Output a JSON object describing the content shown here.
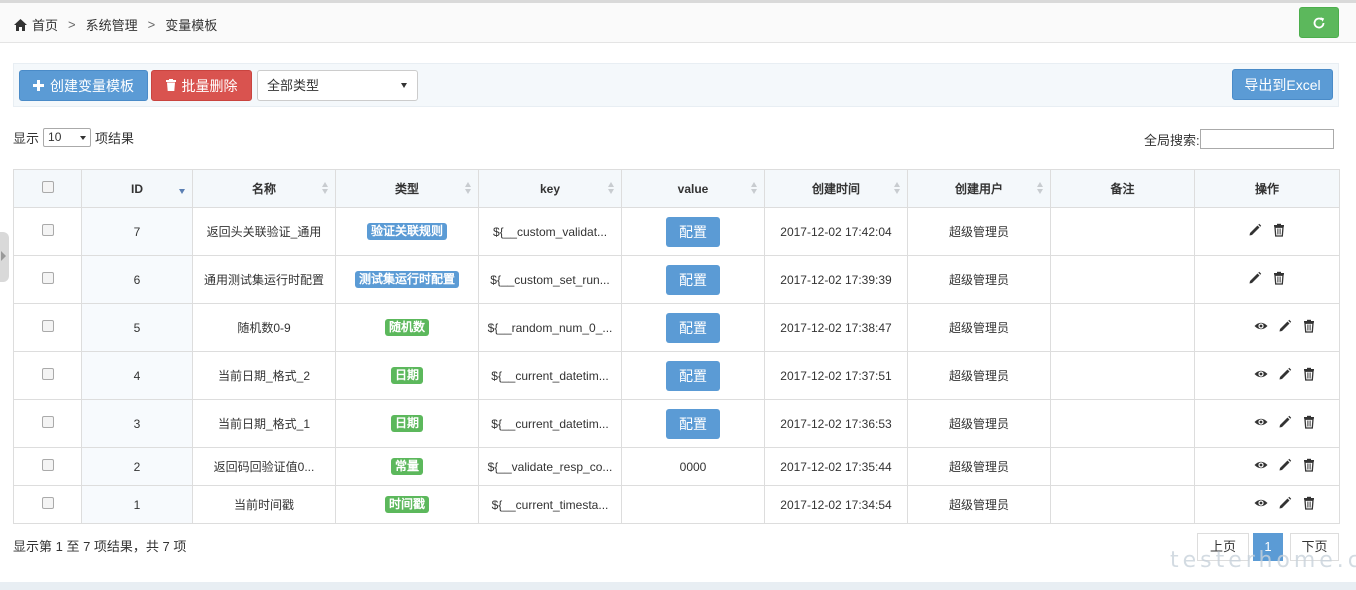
{
  "breadcrumb": {
    "home": "首页",
    "sep": ">",
    "level2": "系统管理",
    "level3": "变量模板"
  },
  "toolbar": {
    "create_label": "创建变量模板",
    "delete_label": "批量删除",
    "type_select": "全部类型",
    "export_label": "导出到Excel"
  },
  "listing": {
    "show_prefix": "显示",
    "length_value": "10",
    "show_suffix": "项结果",
    "search_label": "全局搜索:"
  },
  "columns": {
    "id": "ID",
    "name": "名称",
    "type": "类型",
    "key": "key",
    "value": "value",
    "created": "创建时间",
    "user": "创建用户",
    "remark": "备注",
    "ops": "操作"
  },
  "rows": [
    {
      "id": "7",
      "name": "返回头关联验证_通用",
      "type": "验证关联规则",
      "type_color": "blue",
      "key": "${__custom_validat...",
      "value": "配置",
      "value_is_button": true,
      "created": "2017-12-02 17:42:04",
      "user": "超级管理员",
      "remark": "",
      "has_view": false
    },
    {
      "id": "6",
      "name": "通用测试集运行时配置",
      "type": "测试集运行时配置",
      "type_color": "blue",
      "key": "${__custom_set_run...",
      "value": "配置",
      "value_is_button": true,
      "created": "2017-12-02 17:39:39",
      "user": "超级管理员",
      "remark": "",
      "has_view": false
    },
    {
      "id": "5",
      "name": "随机数0-9",
      "type": "随机数",
      "type_color": "green",
      "key": "${__random_num_0_...",
      "value": "配置",
      "value_is_button": true,
      "created": "2017-12-02 17:38:47",
      "user": "超级管理员",
      "remark": "",
      "has_view": true
    },
    {
      "id": "4",
      "name": "当前日期_格式_2",
      "type": "日期",
      "type_color": "green",
      "key": "${__current_datetim...",
      "value": "配置",
      "value_is_button": true,
      "created": "2017-12-02 17:37:51",
      "user": "超级管理员",
      "remark": "",
      "has_view": true
    },
    {
      "id": "3",
      "name": "当前日期_格式_1",
      "type": "日期",
      "type_color": "green",
      "key": "${__current_datetim...",
      "value": "配置",
      "value_is_button": true,
      "created": "2017-12-02 17:36:53",
      "user": "超级管理员",
      "remark": "",
      "has_view": true
    },
    {
      "id": "2",
      "name": "返回码回验证值0...",
      "type": "常量",
      "type_color": "green",
      "key": "${__validate_resp_co...",
      "value": "0000",
      "value_is_button": false,
      "created": "2017-12-02 17:35:44",
      "user": "超级管理员",
      "remark": "",
      "has_view": true
    },
    {
      "id": "1",
      "name": "当前时间戳",
      "type": "时间戳",
      "type_color": "green",
      "key": "${__current_timesta...",
      "value": "",
      "value_is_button": false,
      "created": "2017-12-02 17:34:54",
      "user": "超级管理员",
      "remark": "",
      "has_view": true
    }
  ],
  "footer": {
    "info": "显示第 1 至 7 项结果，共 7 项",
    "prev": "上页",
    "page": "1",
    "next": "下页"
  },
  "watermark": "testerhome.com",
  "colors": {
    "primary": "#5b9bd5",
    "danger": "#d9534f",
    "success": "#5cb85c"
  }
}
